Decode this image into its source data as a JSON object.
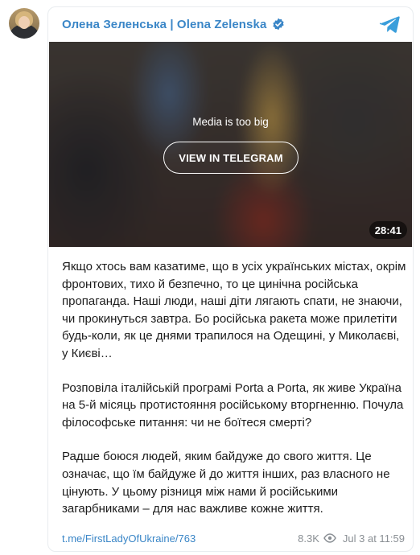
{
  "channel": {
    "name": "Олена Зеленська | Olena Zelenska",
    "verified": true
  },
  "media": {
    "notice": "Media is too big",
    "button_label": "VIEW IN TELEGRAM",
    "duration": "28:41"
  },
  "post": {
    "paragraphs": [
      "Якщо хтось вам казатиме, що в усіх українських містах, окрім фронтових, тихо й безпечно, то це цинічна російська пропаганда. Наші люди, наші діти лягають спати, не знаючи, чи прокинуться завтра. Бо російська ракета може прилетіти будь-коли, як це днями трапилося на Одещині, у Миколаєві, у Києві…",
      "Розповіла італійській програмі Porta a Porta, як живе Україна на 5-й місяць протистояння російському вторгненню. Почула філософське питання: чи не боїтеся смерті?",
      "Радше боюся людей, яким байдуже до свого життя. Це означає, що їм байдуже й до життя інших, раз власного не цінують. У цьому різниця між нами й російськими загарбниками – для нас важливе кожне життя."
    ]
  },
  "footer": {
    "link": "t.me/FirstLadyOfUkraine/763",
    "views": "8.3K",
    "date": "Jul 3 at 11:59"
  },
  "icons": {
    "verified": "verified-badge-icon",
    "telegram": "telegram-plane-icon",
    "views": "eye-icon"
  },
  "colors": {
    "accent": "#3a86c7",
    "muted": "#8a8f94"
  }
}
